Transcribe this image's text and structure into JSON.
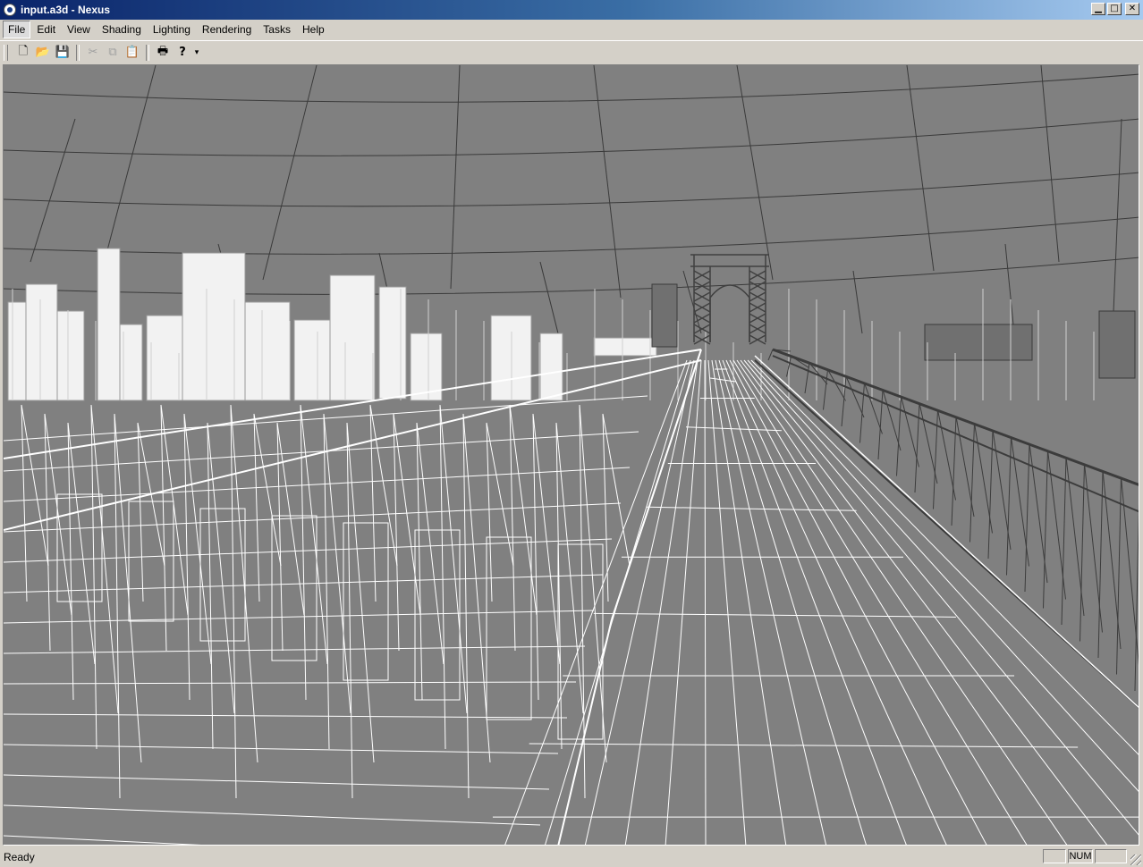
{
  "window": {
    "title": "input.a3d - Nexus",
    "controls": [
      "0",
      "1",
      "r"
    ]
  },
  "menu": [
    {
      "label": "File",
      "active": true
    },
    {
      "label": "Edit"
    },
    {
      "label": "View"
    },
    {
      "label": "Shading"
    },
    {
      "label": "Lighting"
    },
    {
      "label": "Rendering"
    },
    {
      "label": "Tasks"
    },
    {
      "label": "Help"
    }
  ],
  "toolbar": {
    "buttons": [
      {
        "name": "new-file-icon",
        "glyph": "🗋",
        "enabled": true
      },
      {
        "name": "open-folder-icon",
        "glyph": "📂",
        "enabled": true
      },
      {
        "name": "save-icon",
        "glyph": "💾",
        "enabled": true
      },
      {
        "name": "cut-icon",
        "glyph": "✂",
        "enabled": false
      },
      {
        "name": "copy-icon",
        "glyph": "⧉",
        "enabled": false
      },
      {
        "name": "paste-icon",
        "glyph": "📋",
        "enabled": false
      },
      {
        "name": "print-icon",
        "glyph": "🖶",
        "enabled": true
      },
      {
        "name": "help-icon",
        "glyph": "?",
        "enabled": true
      }
    ]
  },
  "viewport": {
    "content": "wireframe-bridge-scene",
    "background": "#808080"
  },
  "status": {
    "text": "Ready",
    "panels": [
      "",
      "NUM",
      ""
    ]
  }
}
